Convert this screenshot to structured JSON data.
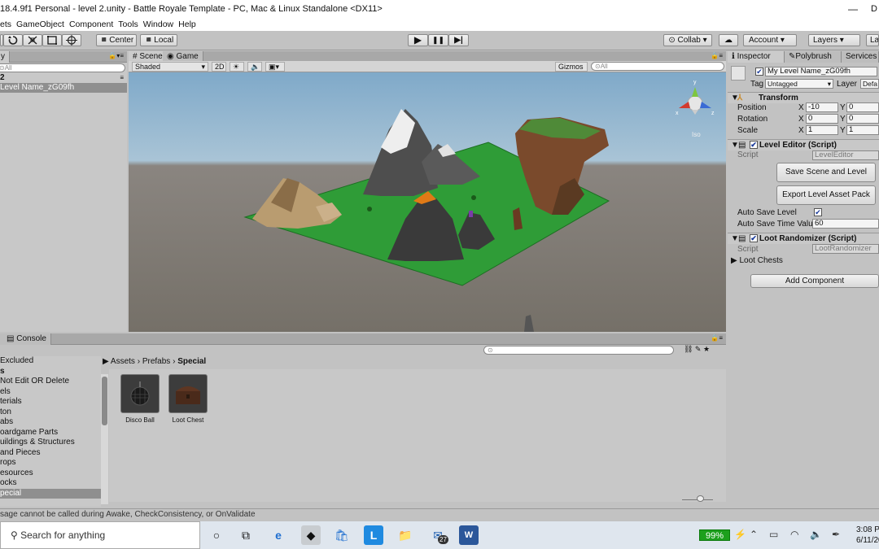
{
  "window": {
    "title": "18.4.9f1 Personal - level 2.unity - Battle Royale Template - PC, Mac & Linux Standalone <DX11>",
    "minimize": "—",
    "right_char": "D"
  },
  "menu": [
    "ets",
    "GameObject",
    "Component",
    "Tools",
    "Window",
    "Help"
  ],
  "toolbar": {
    "center_label": "Center",
    "local_label": "Local",
    "collab_label": "Collab",
    "account_label": "Account",
    "layers_label": "Layers",
    "layout_label": "La",
    "play_glyph": "▶",
    "pause_glyph": "❚❚",
    "step_glyph": "▶|"
  },
  "hierarchy": {
    "tab_label": "y",
    "search_placeholder": "All",
    "scene_name": "2",
    "selected_item": "Level Name_zG09fh"
  },
  "scene": {
    "tab_scene": "Scene",
    "tab_game": "Game",
    "shading": "Shaded",
    "mode_2d": "2D",
    "gizmos": "Gizmos",
    "search_placeholder": "All",
    "persp_label": "Iso"
  },
  "inspector": {
    "tab_inspector": "Inspector",
    "tab_polybrush": "Polybrush",
    "tab_services": "Services",
    "object_name": "My Level Name_zG09fh",
    "tag_label": "Tag",
    "tag_value": "Untagged",
    "layer_label": "Layer",
    "layer_value": "Defa",
    "transform": {
      "title": "Transform",
      "position_label": "Position",
      "rotation_label": "Rotation",
      "scale_label": "Scale",
      "x": "X",
      "y": "Y",
      "position_x": "-10",
      "position_y": "0",
      "rotation_x": "0",
      "rotation_y": "0",
      "scale_x": "1",
      "scale_y": "1"
    },
    "level_editor": {
      "title": "Level Editor (Script)",
      "script_label": "Script",
      "script_value": "LevelEditor",
      "save_button": "Save Scene and Level",
      "export_button": "Export Level Asset Pack",
      "auto_save_label": "Auto Save Level",
      "auto_save_time_label": "Auto Save Time Valu",
      "auto_save_time_value": "60"
    },
    "loot_randomizer": {
      "title": "Loot Randomizer (Script)",
      "script_label": "Script",
      "script_value": "LootRandomizer",
      "loot_chests_label": "Loot Chests"
    },
    "add_component": "Add Component"
  },
  "project": {
    "tab_console": "Console",
    "breadcrumb": [
      "Assets",
      "Prefabs",
      "Special"
    ],
    "tree": [
      "Excluded",
      "s",
      "Not Edit OR Delete",
      "els",
      "terials",
      "ton",
      "abs",
      "oardgame Parts",
      "uildings & Structures",
      "and Pieces",
      "rops",
      "esources",
      "ocks",
      "pecial"
    ],
    "assets": [
      {
        "label": "Disco Ball"
      },
      {
        "label": "Loot Chest"
      }
    ]
  },
  "status": {
    "message": "sage cannot be called during Awake, CheckConsistency, or OnValidate"
  },
  "taskbar": {
    "search_placeholder": "Search for anything",
    "mail_badge": "27",
    "battery": "99%",
    "time": "3:08 P",
    "date": "6/11/20"
  },
  "colors": {
    "accent_blue": "#3a7bd5",
    "selection": "#8f8f8f",
    "ground": "#2e9a3a",
    "battery_green": "#1da01d"
  }
}
